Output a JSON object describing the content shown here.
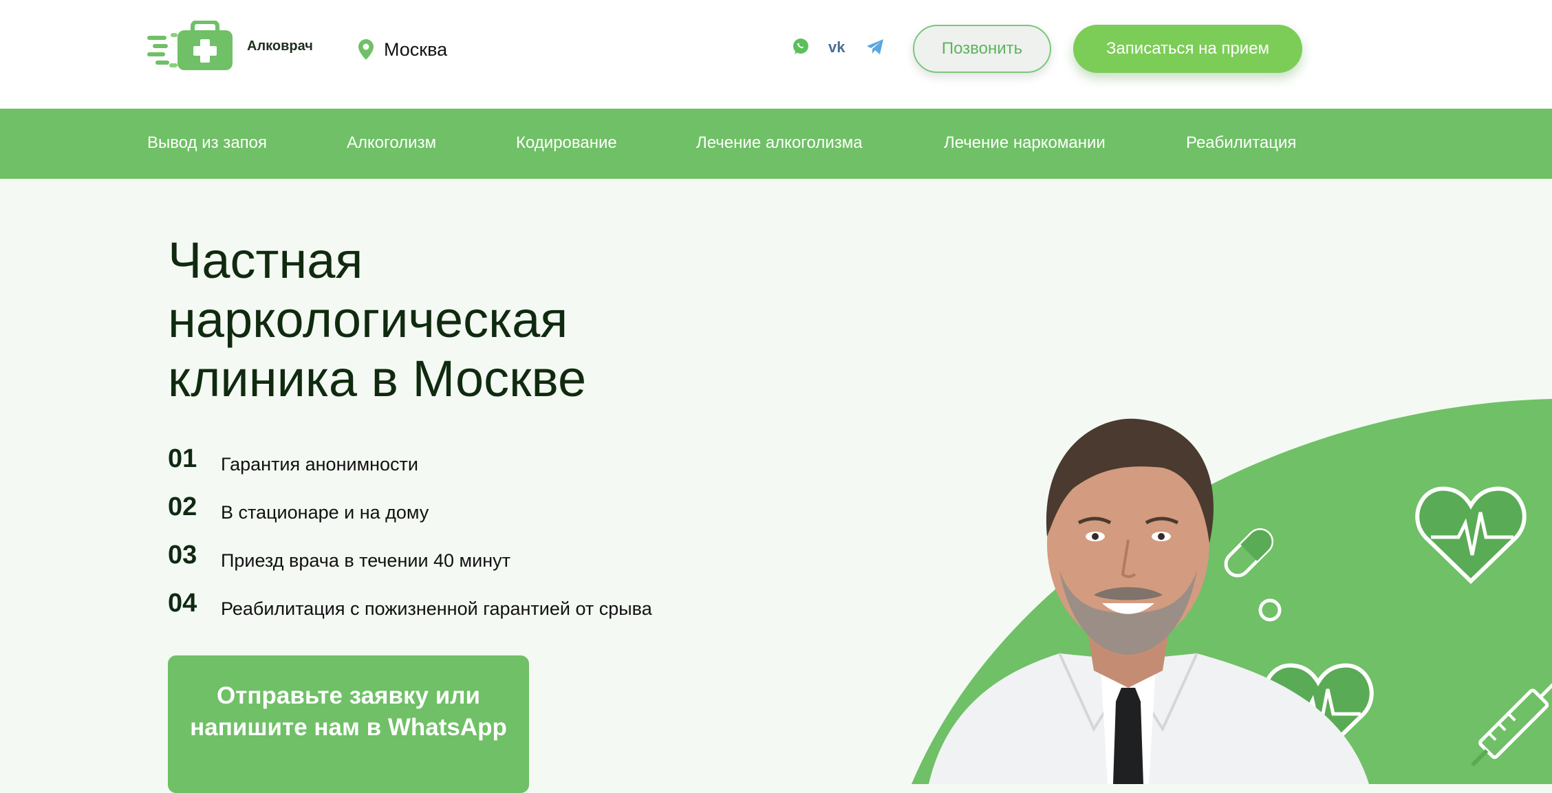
{
  "header": {
    "logo_text": "Алковрач",
    "city": "Москва",
    "call_button": "Позвонить",
    "book_button": "Записаться на прием",
    "socials": [
      "whatsapp-icon",
      "vk-icon",
      "telegram-icon"
    ]
  },
  "nav": {
    "items": [
      {
        "label": "Вывод из запоя"
      },
      {
        "label": "Алкоголизм"
      },
      {
        "label": "Кодирование"
      },
      {
        "label": "Лечение алкоголизма"
      },
      {
        "label": "Лечение наркомании"
      },
      {
        "label": "Реабилитация"
      }
    ]
  },
  "hero": {
    "title": "Частная наркологическая клиника в Москве",
    "features": [
      {
        "num": "01",
        "text": "Гарантия анонимности"
      },
      {
        "num": "02",
        "text": "В стационаре и на дому"
      },
      {
        "num": "03",
        "text": "Приезд врача в течении 40 минут"
      },
      {
        "num": "04",
        "text": "Реабилитация с пожизненной гарантией от срыва"
      }
    ],
    "cta": "Отправьте заявку или напишите нам в WhatsApp"
  },
  "colors": {
    "brand_green": "#6fc066",
    "button_green": "#7ccd57",
    "background": "#f4f9f3",
    "text_dark": "#0f2a12"
  }
}
